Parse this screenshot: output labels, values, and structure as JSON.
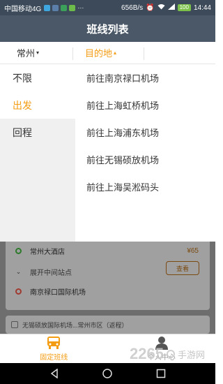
{
  "status_bar": {
    "carrier": "中国移动4G",
    "speed": "656B/s",
    "battery": "100",
    "time": "14:44"
  },
  "header": {
    "title": "班线列表"
  },
  "filter": {
    "city": "常州",
    "destination": "目的地"
  },
  "dropdown": {
    "left_items": [
      {
        "label": "不限"
      },
      {
        "label": "出发"
      },
      {
        "label": "回程"
      }
    ],
    "right_items": [
      {
        "label": "前往南京禄口机场"
      },
      {
        "label": "前往上海虹桥机场"
      },
      {
        "label": "前往上海浦东机场"
      },
      {
        "label": "前往无锡硕放机场"
      },
      {
        "label": "前往上海吴淞码头"
      }
    ]
  },
  "route_card": {
    "origin": "常州大酒店",
    "price": "¥65",
    "expand_label": "展开中间站点",
    "view_label": "查看",
    "destination": "南京禄口国际机场"
  },
  "route_card2": {
    "text": "无锡硕放国际机场...常州市区（返程）"
  },
  "tabbar": {
    "tabs": [
      {
        "label": "固定班线"
      },
      {
        "label": "个人中心"
      }
    ]
  },
  "watermark": {
    "num": "2265",
    "text": "手游网"
  },
  "colors": {
    "accent": "#f39c12",
    "header": "#4a5867",
    "status": "#3c4a59"
  }
}
